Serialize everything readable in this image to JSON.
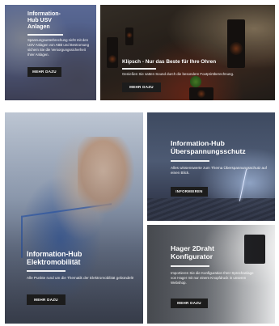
{
  "tiles": [
    {
      "title_line1": "Information-",
      "title_line2": "Hub USV",
      "title_line3": "Anlagen",
      "description": "Spannungsunterbrechung nicht mit den USV Anlagen von ABB und Bestromung sichern Sie die Versorgungssicherheit Ihrer Anlagen.",
      "button_label": "MEHR DAZU"
    },
    {
      "title": "Klipsch - Nur das Beste für Ihre Ohren",
      "description": "Genießen Sie satten Sound durch die besondere Footprintberechnung.",
      "button_label": "MEHR DAZU"
    },
    {
      "title_line1": "Information-Hub",
      "title_line2": "Elektromobilität",
      "description": "Alle Punkte rund um die Thematik der Elektromobilität gebündelt!",
      "button_label": "MEHR DAZU"
    },
    {
      "title_line1": "Information-Hub",
      "title_line2": "Überspannungsschutz",
      "description": "Alles wissenswerte zum Thema Überspannungsschutz auf einen Blick.",
      "button_label": "INFORMIEREN"
    },
    {
      "title_line1": "Hager 2Draht",
      "title_line2": "Konfigurator",
      "description": "Importieren Sie die Konfiguration Ihrer Sprechanlage von Hager mit nur einem Knopfdruck in unseren Webshop.",
      "button_label": "MEHR DAZU"
    }
  ]
}
